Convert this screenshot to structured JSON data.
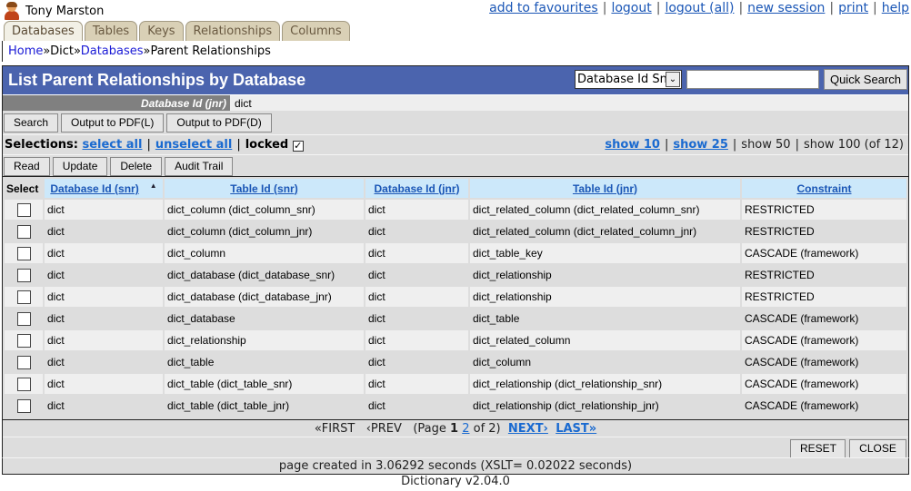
{
  "user": {
    "name": "Tony Marston",
    "icon": "user-icon"
  },
  "top_links": [
    "add to favourites",
    "logout",
    "logout (all)",
    "new session",
    "print",
    "help"
  ],
  "tabs": [
    {
      "label": "Databases",
      "active": true
    },
    {
      "label": "Tables",
      "active": false
    },
    {
      "label": "Keys",
      "active": false
    },
    {
      "label": "Relationships",
      "active": false
    },
    {
      "label": "Columns",
      "active": false
    }
  ],
  "breadcrumb": {
    "home": "Home",
    "sep": "»",
    "dict": "Dict",
    "databases": "Databases",
    "current": "Parent Relationships"
  },
  "title": "List Parent Relationships by Database",
  "quick_search": {
    "field": "Database Id Snr",
    "value": "",
    "button": "Quick Search"
  },
  "filter": {
    "label": "Database Id (jnr)",
    "value": "dict"
  },
  "buttons_top": [
    "Search",
    "Output to PDF(L)",
    "Output to PDF(D)"
  ],
  "selections": {
    "label": "Selections:",
    "select_all": "select all",
    "unselect_all": "unselect all",
    "locked": "locked",
    "locked_checked": true,
    "sep": "|"
  },
  "show": {
    "show10": "show 10",
    "show25": "show 25",
    "show50": "show 50",
    "show100": "show 100 (of 12)",
    "sep": "|"
  },
  "buttons_action": [
    "Read",
    "Update",
    "Delete",
    "Audit Trail"
  ],
  "table": {
    "select_header": "Select",
    "columns": [
      "Database Id (snr)",
      "Table Id (snr)",
      "Database Id (jnr)",
      "Table Id (jnr)",
      "Constraint"
    ],
    "sort_indicator": "▲",
    "rows": [
      [
        "dict",
        "dict_column (dict_column_snr)",
        "dict",
        "dict_related_column (dict_related_column_snr)",
        "RESTRICTED"
      ],
      [
        "dict",
        "dict_column (dict_column_jnr)",
        "dict",
        "dict_related_column (dict_related_column_jnr)",
        "RESTRICTED"
      ],
      [
        "dict",
        "dict_column",
        "dict",
        "dict_table_key",
        "CASCADE (framework)"
      ],
      [
        "dict",
        "dict_database (dict_database_snr)",
        "dict",
        "dict_relationship",
        "RESTRICTED"
      ],
      [
        "dict",
        "dict_database (dict_database_jnr)",
        "dict",
        "dict_relationship",
        "RESTRICTED"
      ],
      [
        "dict",
        "dict_database",
        "dict",
        "dict_table",
        "CASCADE (framework)"
      ],
      [
        "dict",
        "dict_relationship",
        "dict",
        "dict_related_column",
        "CASCADE (framework)"
      ],
      [
        "dict",
        "dict_table",
        "dict",
        "dict_column",
        "CASCADE (framework)"
      ],
      [
        "dict",
        "dict_table (dict_table_snr)",
        "dict",
        "dict_relationship (dict_relationship_snr)",
        "CASCADE (framework)"
      ],
      [
        "dict",
        "dict_table (dict_table_jnr)",
        "dict",
        "dict_relationship (dict_relationship_jnr)",
        "CASCADE (framework)"
      ]
    ]
  },
  "pager": {
    "first": "«FIRST",
    "prev": "‹PREV",
    "page_prefix": "(Page",
    "current": "1",
    "next_page": "2",
    "page_suffix": "of 2)",
    "next": "NEXT›",
    "last": "LAST»"
  },
  "footer_buttons": {
    "reset": "RESET",
    "close": "CLOSE"
  },
  "timing": "page created in 3.06292 seconds (XSLT= 0.02022 seconds)",
  "version": "Dictionary v2.04.0"
}
